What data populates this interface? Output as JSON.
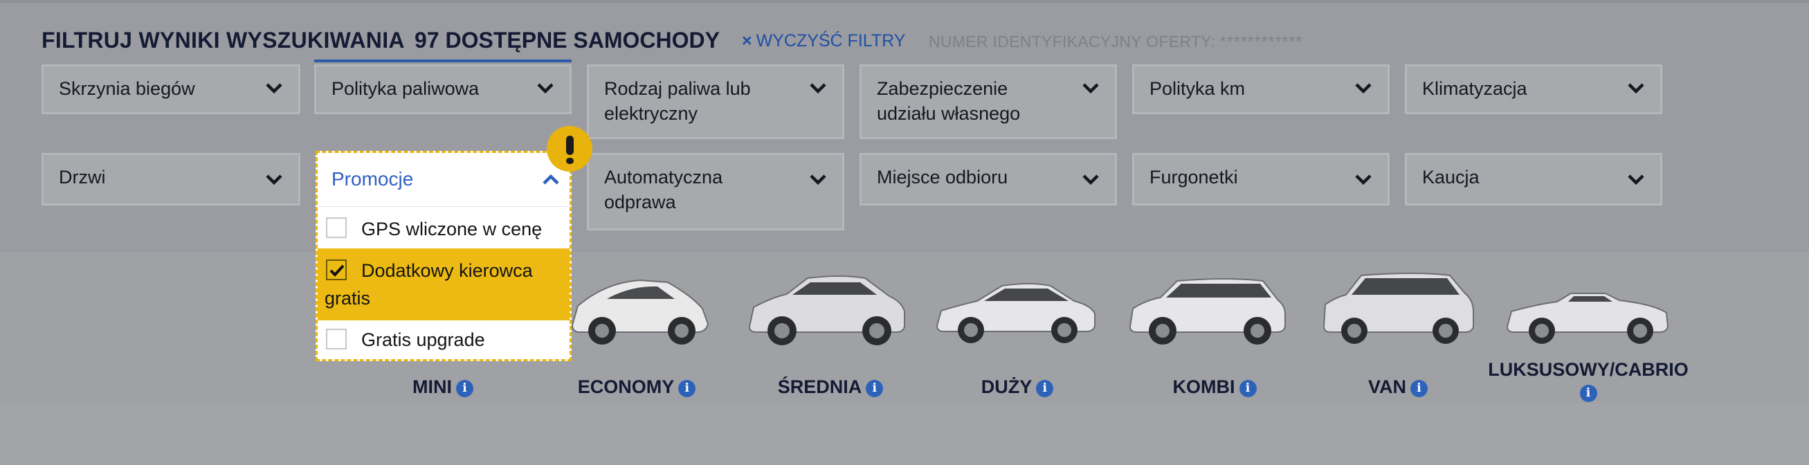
{
  "header": {
    "title": "FILTRUJ WYNIKI WYSZUKIWANIA",
    "count": "97 DOSTĘPNE SAMOCHODY",
    "clear_icon": "×",
    "clear_label": "WYCZYŚĆ FILTRY",
    "offer_id_label": "NUMER IDENTYFIKACYJNY OFERTY:",
    "offer_id_value": "************"
  },
  "filters": {
    "row1": [
      {
        "label": "Skrzynia biegów"
      },
      {
        "label": "Polityka paliwowa"
      },
      {
        "label": "Rodzaj paliwa lub elektryczny"
      },
      {
        "label": "Zabezpieczenie udziału własnego"
      },
      {
        "label": "Polityka km"
      },
      {
        "label": "Klimatyzacja"
      }
    ],
    "row2": [
      {
        "label": "Drzwi"
      },
      {
        "label": "Promocje"
      },
      {
        "label": "Automatyczna odprawa"
      },
      {
        "label": "Miejsce odbioru"
      },
      {
        "label": "Furgonetki"
      },
      {
        "label": "Kaucja"
      }
    ]
  },
  "promotions_dropdown": {
    "title": "Promocje",
    "options": [
      {
        "label": "GPS wliczone w cenę",
        "checked": false
      },
      {
        "label": "Dodatkowy kierowca gratis",
        "checked": true
      },
      {
        "label": "Gratis upgrade",
        "checked": false
      }
    ],
    "highlight_color": "#ecba12"
  },
  "alert_badge": {
    "symbol": "!"
  },
  "car_categories": [
    {
      "label": "MINI",
      "info": "i"
    },
    {
      "label": "ECONOMY",
      "info": "i"
    },
    {
      "label": "ŚREDNIA",
      "info": "i"
    },
    {
      "label": "DUŻY",
      "info": "i"
    },
    {
      "label": "KOMBI",
      "info": "i"
    },
    {
      "label": "VAN",
      "info": "i"
    },
    {
      "label": "LUKSUSOWY/CABRIO",
      "info": "i"
    }
  ],
  "colors": {
    "accent_blue": "#2c5aa8",
    "title_navy": "#141a33",
    "alert_yellow": "#e8b30c"
  }
}
